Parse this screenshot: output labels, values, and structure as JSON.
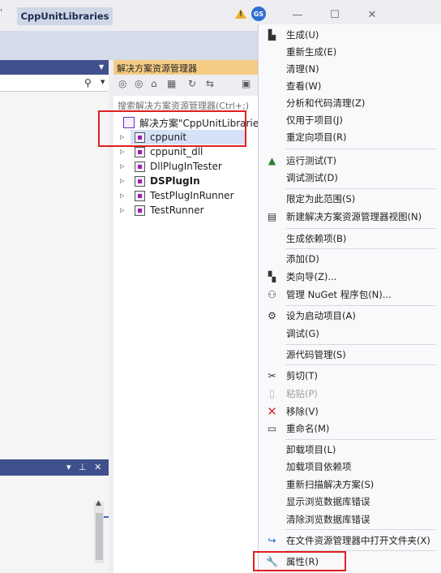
{
  "window": {
    "title": "CppUnitLibraries",
    "title_fragment": "'",
    "avatar_initials": "GS",
    "controls": {
      "minimize": "—",
      "maximize": "☐",
      "close": "✕"
    }
  },
  "solution_explorer": {
    "title": "解决方案资源管理器",
    "search_placeholder": "搜索解决方案资源管理器(Ctrl+;)",
    "solution_label": "解决方案\"CppUnitLibraries\"",
    "projects": [
      {
        "name": "cppunit",
        "bold": false,
        "selected": true
      },
      {
        "name": "cppunit_dll",
        "bold": false
      },
      {
        "name": "DllPlugInTester",
        "bold": false
      },
      {
        "name": "DSPlugIn",
        "bold": true
      },
      {
        "name": "TestPlugInRunner",
        "bold": false
      },
      {
        "name": "TestRunner",
        "bold": false
      }
    ]
  },
  "context_menu": {
    "items": [
      {
        "label": "生成(U)",
        "icon": "build-icon"
      },
      {
        "label": "重新生成(E)"
      },
      {
        "label": "清理(N)"
      },
      {
        "label": "查看(W)"
      },
      {
        "label": "分析和代码清理(Z)"
      },
      {
        "label": "仅用于项目(J)"
      },
      {
        "label": "重定向项目(R)"
      },
      {
        "label": "运行测试(T)",
        "icon": "run-tests-icon"
      },
      {
        "label": "调试测试(D)"
      },
      {
        "label": "限定为此范围(S)"
      },
      {
        "label": "新建解决方案资源管理器视图(N)",
        "icon": "new-view-icon"
      },
      {
        "label": "生成依赖项(B)"
      },
      {
        "label": "添加(D)"
      },
      {
        "label": "类向导(Z)...",
        "icon": "class-wizard-icon"
      },
      {
        "label": "管理 NuGet 程序包(N)...",
        "icon": "nuget-icon"
      },
      {
        "label": "设为启动项目(A)",
        "icon": "gear-icon"
      },
      {
        "label": "调试(G)"
      },
      {
        "label": "源代码管理(S)"
      },
      {
        "label": "剪切(T)",
        "icon": "cut-icon"
      },
      {
        "label": "粘贴(P)",
        "icon": "paste-icon",
        "disabled": true
      },
      {
        "label": "移除(V)",
        "icon": "remove-icon"
      },
      {
        "label": "重命名(M)",
        "icon": "rename-icon"
      },
      {
        "label": "卸载项目(L)"
      },
      {
        "label": "加载项目依赖项"
      },
      {
        "label": "重新扫描解决方案(S)"
      },
      {
        "label": "显示浏览数据库错误"
      },
      {
        "label": "清除浏览数据库错误"
      },
      {
        "label": "在文件资源管理器中打开文件夹(X)",
        "icon": "open-folder-icon"
      },
      {
        "label": "属性(R)",
        "icon": "wrench-icon",
        "highlighted": true
      }
    ]
  },
  "colors": {
    "accent": "#40508d",
    "solution_header": "#f5cc84",
    "highlight_box": "#e02020",
    "remove": "#d32f2f"
  }
}
